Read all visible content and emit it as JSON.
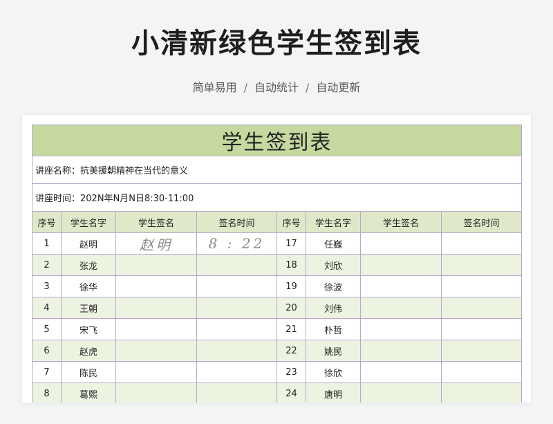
{
  "page": {
    "title": "小清新绿色学生签到表",
    "subtitle_items": [
      "简单易用",
      "自动统计",
      "自动更新"
    ],
    "separator": "/"
  },
  "sheet": {
    "title": "学生签到表",
    "lecture_name": "讲座名称：抗美援朝精神在当代的意义",
    "lecture_time": "讲座时间：202N年N月N日8:30-11:00",
    "headers": [
      "序号",
      "学生名字",
      "学生签名",
      "签名时间",
      "序号",
      "学生名字",
      "学生签名",
      "签名时间"
    ],
    "rows": [
      {
        "no1": "1",
        "name1": "赵明",
        "sign1": "赵明",
        "time1": "8 : 22",
        "no2": "17",
        "name2": "任巍",
        "sign2": "",
        "time2": ""
      },
      {
        "no1": "2",
        "name1": "张龙",
        "sign1": "",
        "time1": "",
        "no2": "18",
        "name2": "刘欣",
        "sign2": "",
        "time2": ""
      },
      {
        "no1": "3",
        "name1": "徐华",
        "sign1": "",
        "time1": "",
        "no2": "19",
        "name2": "徐波",
        "sign2": "",
        "time2": ""
      },
      {
        "no1": "4",
        "name1": "王朝",
        "sign1": "",
        "time1": "",
        "no2": "20",
        "name2": "刘伟",
        "sign2": "",
        "time2": ""
      },
      {
        "no1": "5",
        "name1": "宋飞",
        "sign1": "",
        "time1": "",
        "no2": "21",
        "name2": "朴哲",
        "sign2": "",
        "time2": ""
      },
      {
        "no1": "6",
        "name1": "赵虎",
        "sign1": "",
        "time1": "",
        "no2": "22",
        "name2": "姚民",
        "sign2": "",
        "time2": ""
      },
      {
        "no1": "7",
        "name1": "陈民",
        "sign1": "",
        "time1": "",
        "no2": "23",
        "name2": "徐欣",
        "sign2": "",
        "time2": ""
      },
      {
        "no1": "8",
        "name1": "葛熙",
        "sign1": "",
        "time1": "",
        "no2": "24",
        "name2": "唐明",
        "sign2": "",
        "time2": ""
      }
    ]
  },
  "colors": {
    "title_bg": "#c6d9a0",
    "header_bg": "#dfe9c9",
    "alt_row_bg": "#edf3e1",
    "border": "#b7a6cf"
  }
}
